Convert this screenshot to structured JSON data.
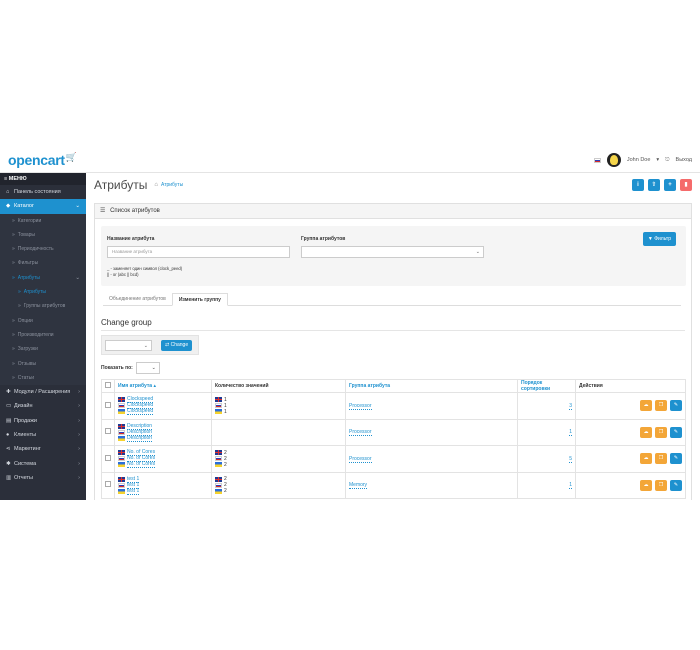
{
  "brand": {
    "name": "opencart",
    "cart_icon": "cart-icon"
  },
  "header": {
    "user_name": "John Doe",
    "logout_label": "Выход"
  },
  "sidebar": {
    "menu_label": "МЕНЮ",
    "dashboard": "Панель состояния",
    "catalog": "Каталог",
    "catalog_items": [
      "Категории",
      "Товары",
      "Периодичность",
      "Фильтры"
    ],
    "attributes": "Атрибуты",
    "attributes_items": [
      "Атрибуты",
      "Группы атрибутов"
    ],
    "catalog_items_after": [
      "Опции",
      "Производители",
      "Загрузки",
      "Отзывы",
      "Статьи"
    ],
    "bottom_items": [
      "Модули / Расширения",
      "Дизайн",
      "Продажи",
      "Клиенты",
      "Маркетинг",
      "Система",
      "Отчеты"
    ]
  },
  "page": {
    "title": "Атрибуты",
    "breadcrumb": "Атрибуты"
  },
  "panel": {
    "title": "Список атрибутов"
  },
  "filter": {
    "name_label": "Название атрибута",
    "name_placeholder": "Название атрибута",
    "group_label": "Группа атрибутов",
    "hint_line1": "_ - заменяет один символ (clock_peed)",
    "hint_line2": "|| - or (abc || bcd)",
    "button_label": "Фильтр"
  },
  "tabs": [
    "Объединение атрибутов",
    "Изменить группу"
  ],
  "change_group": {
    "title": "Change group",
    "button_label": "Change"
  },
  "showby": {
    "label": "Показать по:"
  },
  "table": {
    "headers": {
      "name": "Имя атрибута",
      "count": "Количество значений",
      "group": "Группа атрибута",
      "sort": "Порядок сортировки",
      "actions": "Действия"
    },
    "rows": [
      {
        "names": [
          "Clockspeed",
          "Clockspeed",
          "Clockspeed"
        ],
        "counts": [
          "1",
          "1",
          "1"
        ],
        "group": "Processor",
        "sort": "3"
      },
      {
        "names": [
          "Description",
          "Description",
          "Description"
        ],
        "counts": [],
        "group": "Processor",
        "sort": "1"
      },
      {
        "names": [
          "No. of Cores",
          "No. of Cores",
          "No. of Cores"
        ],
        "counts": [
          "2",
          "2",
          "2"
        ],
        "group": "Processor",
        "sort": "5"
      },
      {
        "names": [
          "test 1",
          "test 1",
          "test 1"
        ],
        "counts": [
          "2",
          "2",
          "2"
        ],
        "group": "Memory",
        "sort": "1"
      }
    ]
  },
  "colors": {
    "primary": "#1e91cf",
    "sidebar_bg": "#2b2f3a",
    "danger": "#f56b6b",
    "warning": "#f3a638"
  }
}
